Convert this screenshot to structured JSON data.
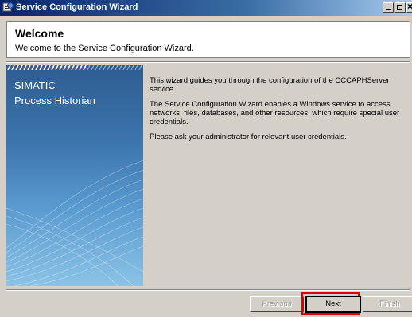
{
  "window": {
    "title": "Service Configuration Wizard",
    "icon": "wizard-app-icon"
  },
  "header": {
    "title": "Welcome",
    "subtitle": "Welcome to the Service Configuration Wizard."
  },
  "sidebar": {
    "line1": "SIMATIC",
    "line2": "Process Historian"
  },
  "content": {
    "paragraphs": [
      "This wizard guides you through the configuration of the CCCAPHServer service.",
      "The Service Configuration Wizard enables a Windows service to access networks, files, databases, and other resources, which require special user credentials.",
      "Please ask your administrator for relevant user credentials."
    ]
  },
  "buttons": {
    "previous": "Previous",
    "next": "Next",
    "finish": "Finish"
  },
  "colors": {
    "titlebar": "#0a246a",
    "highlight": "#e00000",
    "sidebar": "#3c75ad"
  }
}
